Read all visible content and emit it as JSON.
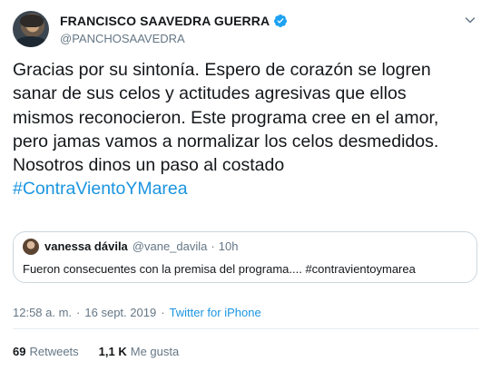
{
  "author": {
    "display_name": "FRANCISCO SAAVEDRA GUERRA",
    "handle": "@PANCHOSAAVEDRA",
    "verified": true
  },
  "tweet": {
    "text_lines": [
      "Gracias por su sintonía. Espero de corazón se logren",
      "sanar de sus celos y actitudes agresivas que ellos",
      "mismos reconocieron. Este programa cree en el amor,",
      "pero jamas vamos a normalizar los celos desmedidos.",
      "Nosotros dinos un paso al costado"
    ],
    "hashtag": "#ContraVientoYMarea"
  },
  "quoted_tweet": {
    "display_name": "vanessa dávila",
    "handle": "@vane_davila",
    "separator": "·",
    "time": "10h",
    "text": "Fueron consecuentes con la premisa del programa....  #contravientoymarea"
  },
  "meta": {
    "time": "12:58 a. m.",
    "separator": "·",
    "date": "16 sept. 2019",
    "source": "Twitter for iPhone"
  },
  "stats": {
    "retweets_count": "69",
    "retweets_label": "Retweets",
    "likes_count": "1,1 K",
    "likes_label": "Me gusta"
  },
  "colors": {
    "link": "#1b95e0",
    "secondary_text": "#657786",
    "border": "#ccd6dd",
    "verified_badge": "#1da1f2"
  },
  "icons": {
    "verified": "verified-badge-icon",
    "menu": "chevron-down-icon"
  }
}
